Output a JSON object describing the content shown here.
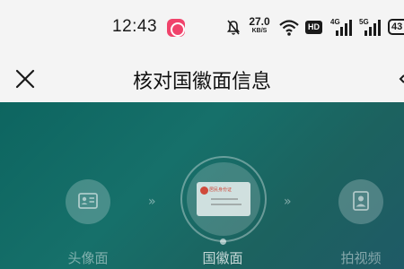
{
  "status_bar": {
    "time": "12:43",
    "net_speed_value": "27.0",
    "net_speed_unit": "KB/S",
    "hd_label": "HD",
    "sim1_label": "4G",
    "sim2_label": "5G",
    "battery": "43",
    "icons": [
      "app-badge-icon",
      "mute-bell-icon",
      "wifi-icon",
      "hd-icon",
      "signal-icon",
      "signal-icon",
      "battery-icon"
    ]
  },
  "nav": {
    "title": "核对国徽面信息",
    "close_icon": "close-icon"
  },
  "steps": [
    {
      "label": "头像面",
      "icon": "portrait-card-icon",
      "state": "inactive"
    },
    {
      "label": "国徽面",
      "icon": "emblem-card-icon",
      "state": "active",
      "card_text": "居民身份证"
    },
    {
      "label": "拍视频",
      "icon": "person-frame-icon",
      "state": "inactive"
    }
  ],
  "step_separator": "»",
  "colors": {
    "hero_gradient_start": "#0d6560",
    "hero_gradient_end": "#1f5a66",
    "status_bg": "#f4f4f4",
    "emblem_red": "#d04a3b",
    "app_badge": "#f0436b"
  }
}
